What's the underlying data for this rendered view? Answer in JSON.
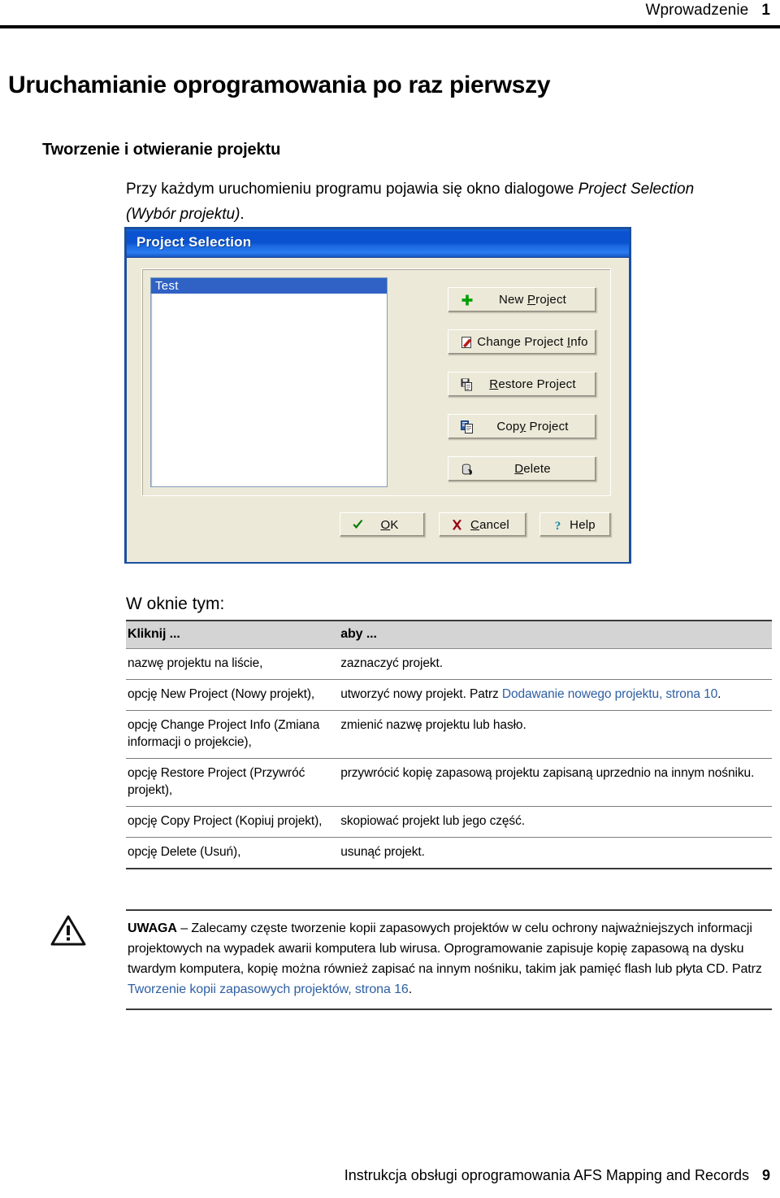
{
  "header": {
    "chapter_label": "Wprowadzenie",
    "page_number": "1"
  },
  "chapter_title": "Uruchamianie oprogramowania po raz pierwszy",
  "section_title": "Tworzenie i otwieranie projektu",
  "intro": {
    "text_before": "Przy każdym uruchomieniu programu pojawia się okno dialogowe ",
    "italic_part": "Project Selection (Wybór projektu)",
    "text_after": "."
  },
  "dialog": {
    "title": "Project Selection",
    "list": {
      "items": [
        {
          "label": "Test",
          "selected": true
        }
      ]
    },
    "buttons": [
      {
        "icon": "plus-icon",
        "label_pre": "New ",
        "label_acc": "P",
        "label_post": "roject"
      },
      {
        "icon": "change-info-icon",
        "label_pre": "Change Project ",
        "label_acc": "I",
        "label_post": "nfo"
      },
      {
        "icon": "restore-icon",
        "label_pre": "",
        "label_acc": "R",
        "label_post": "estore Project"
      },
      {
        "icon": "copy-icon",
        "label_pre": "Cop",
        "label_acc": "y",
        "label_post": " Project"
      },
      {
        "icon": "trash-icon",
        "label_pre": "",
        "label_acc": "D",
        "label_post": "elete"
      }
    ],
    "footer_buttons": [
      {
        "icon": "check-icon",
        "label_pre": "",
        "label_acc": "O",
        "label_post": "K"
      },
      {
        "icon": "cross-icon",
        "label_pre": "",
        "label_acc": "C",
        "label_post": "ancel"
      },
      {
        "icon": "question-icon",
        "label_pre": "Help",
        "label_acc": "",
        "label_post": ""
      }
    ],
    "colors": {
      "titlebar_blue": "#0a52cf",
      "selection_blue": "#2f62c4",
      "face": "#ece9d8"
    }
  },
  "list_intro": "W oknie tym:",
  "table": {
    "headers": {
      "action": "Kliknij ...",
      "result": "aby ..."
    },
    "rows": [
      {
        "action": "nazwę projektu na liście,",
        "result_text": "zaznaczyć projekt.",
        "result_link": "",
        "result_tail": ""
      },
      {
        "action": "opcję New Project (Nowy projekt),",
        "result_text": "utworzyć nowy projekt. Patrz ",
        "result_link": "Dodawanie nowego projektu, strona 10",
        "result_tail": "."
      },
      {
        "action": "opcję Change Project Info (Zmiana informacji o projekcie),",
        "result_text": "zmienić nazwę projektu lub hasło.",
        "result_link": "",
        "result_tail": ""
      },
      {
        "action": "opcję Restore Project (Przywróć projekt),",
        "result_text": "przywrócić kopię zapasową projektu zapisaną uprzednio na innym nośniku.",
        "result_link": "",
        "result_tail": ""
      },
      {
        "action": "opcję Copy Project (Kopiuj projekt),",
        "result_text": "skopiować projekt lub jego część.",
        "result_link": "",
        "result_tail": ""
      },
      {
        "action": "opcję Delete (Usuń),",
        "result_text": "usunąć projekt.",
        "result_link": "",
        "result_tail": ""
      }
    ]
  },
  "caution": {
    "lead": "UWAGA",
    "body_before": " – Zalecamy częste tworzenie kopii zapasowych projektów w celu ochrony najważniejszych informacji projektowych na wypadek awarii komputera lub wirusa. Oprogramowanie zapisuje kopię zapasową na dysku twardym komputera, kopię można również zapisać na innym nośniku, takim jak pamięć flash lub płyta CD. Patrz ",
    "link": "Tworzenie kopii zapasowych projektów, strona 16",
    "body_after": "."
  },
  "footer": {
    "text": "Instrukcja obsługi oprogramowania AFS Mapping and Records",
    "page_number": "9"
  }
}
